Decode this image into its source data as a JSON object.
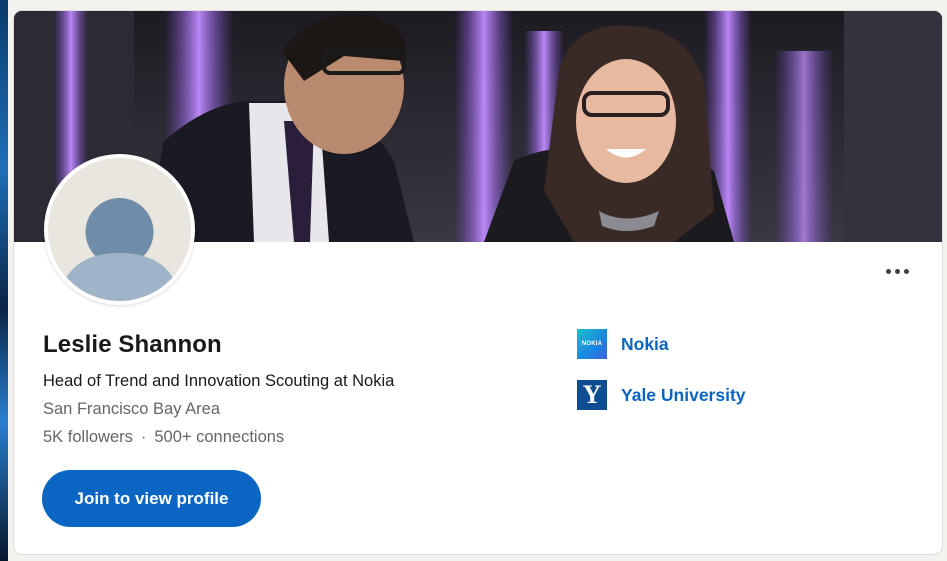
{
  "profile": {
    "name": "Leslie Shannon",
    "headline": "Head of Trend and Innovation Scouting at Nokia",
    "location": "San Francisco Bay Area",
    "followers": "5K followers",
    "separator": "·",
    "connections": "500+ connections",
    "join_label": "Join to view profile"
  },
  "organizations": [
    {
      "name": "Nokia",
      "logo_text": "NOKIA",
      "logo": "nokia-logo"
    },
    {
      "name": "Yale University",
      "logo_text": "Y",
      "logo": "yale-logo"
    }
  ],
  "icons": {
    "more": "ellipsis-icon",
    "avatar": "default-avatar-icon"
  },
  "colors": {
    "accent": "#0a66c2",
    "text_primary": "#191919",
    "text_secondary": "#666666",
    "card_bg": "#ffffff",
    "page_bg": "#f4f2ee",
    "yale_blue": "#0f4d92"
  }
}
